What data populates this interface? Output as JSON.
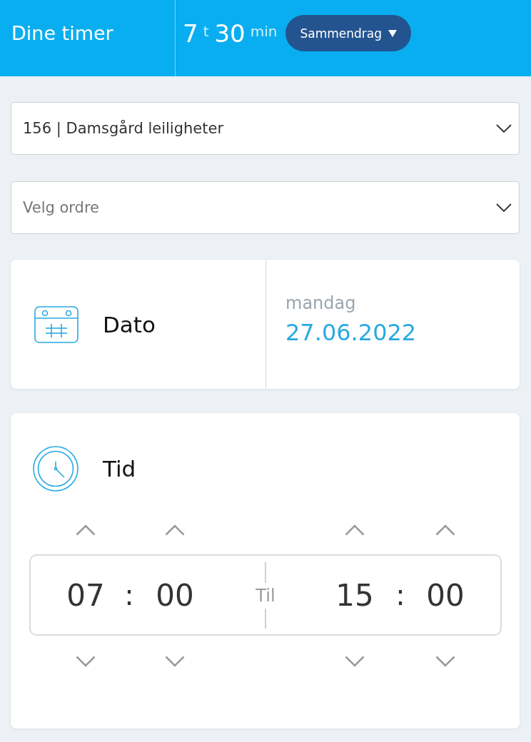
{
  "header": {
    "title": "Dine timer",
    "hours": "7",
    "hours_unit": "t",
    "minutes": "30",
    "minutes_unit": "min",
    "summary_button": {
      "label": "Sammendrag"
    }
  },
  "selects": [
    {
      "value": "156 | Damsgård leiligheter"
    },
    {
      "placeholder": "Velg ordre"
    }
  ],
  "date_card": {
    "label": "Dato",
    "weekday": "mandag",
    "date": "27.06.2022"
  },
  "time_card": {
    "label": "Tid",
    "start": {
      "hours": "07",
      "separator": ":",
      "minutes": "00"
    },
    "range_label": "Til",
    "end": {
      "hours": "15",
      "separator": ":",
      "minutes": "00"
    }
  }
}
